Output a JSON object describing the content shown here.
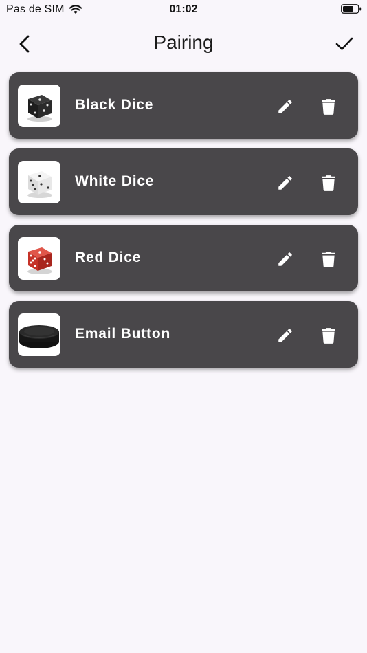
{
  "status_bar": {
    "carrier": "Pas de SIM",
    "time": "01:02",
    "wifi_icon": "wifi-icon",
    "battery_icon": "battery-icon"
  },
  "nav": {
    "title": "Pairing",
    "back_icon": "chevron-left-icon",
    "confirm_icon": "checkmark-icon"
  },
  "devices": [
    {
      "name": "Black Dice",
      "thumbnail": "black-dice-image",
      "color": "#222222"
    },
    {
      "name": "White Dice",
      "thumbnail": "white-dice-image",
      "color": "#eeeeee"
    },
    {
      "name": "Red Dice",
      "thumbnail": "red-dice-image",
      "color": "#c9382b"
    },
    {
      "name": "Email Button",
      "thumbnail": "email-button-image",
      "color": "#1c1c1c"
    }
  ],
  "actions": {
    "edit_icon": "pencil-icon",
    "delete_icon": "trash-icon"
  },
  "colors": {
    "background": "#f9f6fb",
    "card": "#49474a",
    "card_text": "#ffffff"
  }
}
